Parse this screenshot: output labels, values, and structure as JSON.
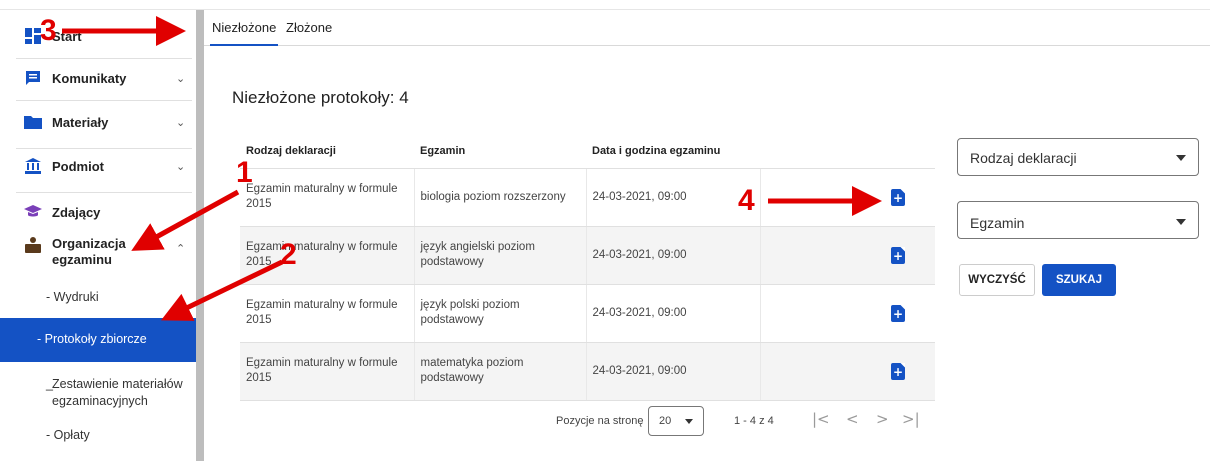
{
  "sidebar": {
    "items": [
      {
        "label": "Start",
        "icon": "dashboard-icon"
      },
      {
        "label": "Komunikaty",
        "icon": "message-icon"
      },
      {
        "label": "Materiały",
        "icon": "folder-icon"
      },
      {
        "label": "Podmiot",
        "icon": "institution-icon"
      },
      {
        "label": "Zdający",
        "icon": "graduation-cap-icon"
      },
      {
        "label": "Organizacja",
        "label2": "egzaminu",
        "icon": "person-desk-icon"
      }
    ],
    "subitems": [
      {
        "label": "- Wydruki"
      },
      {
        "label": "- Protokoły zbiorcze"
      },
      {
        "label": "Zestawienie materiałów",
        "label2": "egzaminacyjnych",
        "prefix": "_"
      },
      {
        "label": "- Opłaty"
      }
    ]
  },
  "tabs": [
    {
      "label": "Niezłożone"
    },
    {
      "label": "Złożone"
    }
  ],
  "main": {
    "title": "Niezłożone protokoły: 4"
  },
  "table": {
    "columns": [
      "Rodzaj deklaracji",
      "Egzamin",
      "Data i godzina egzaminu"
    ],
    "rows": [
      {
        "rodzaj": "Egzamin maturalny w formule 2015",
        "egzamin": "biologia poziom rozszerzony",
        "data": "24-03-2021, 09:00"
      },
      {
        "rodzaj": "Egzamin maturalny w formule 2015",
        "egzamin": "język angielski poziom podstawowy",
        "data": "24-03-2021, 09:00"
      },
      {
        "rodzaj": "Egzamin maturalny w formule 2015",
        "egzamin": "język polski poziom podstawowy",
        "data": "24-03-2021, 09:00"
      },
      {
        "rodzaj": "Egzamin maturalny w formule 2015",
        "egzamin": "matematyka poziom podstawowy",
        "data": "24-03-2021, 09:00"
      }
    ]
  },
  "pager": {
    "label": "Pozycje na stronę",
    "per_page": "20",
    "range": "1 - 4 z 4",
    "first": "|<",
    "prev": "<",
    "next": ">",
    "last": ">|"
  },
  "filters": {
    "rodzaj_placeholder": "Rodzaj deklaracji",
    "egzamin_placeholder": "Egzamin",
    "clear_label": "WYCZYŚĆ",
    "search_label": "SZUKAJ"
  },
  "annotations": {
    "n1": "1",
    "n2": "2",
    "n3": "3",
    "n4": "4",
    "arrow_color": "#e00000"
  },
  "colors": {
    "accent": "#1452c4"
  }
}
